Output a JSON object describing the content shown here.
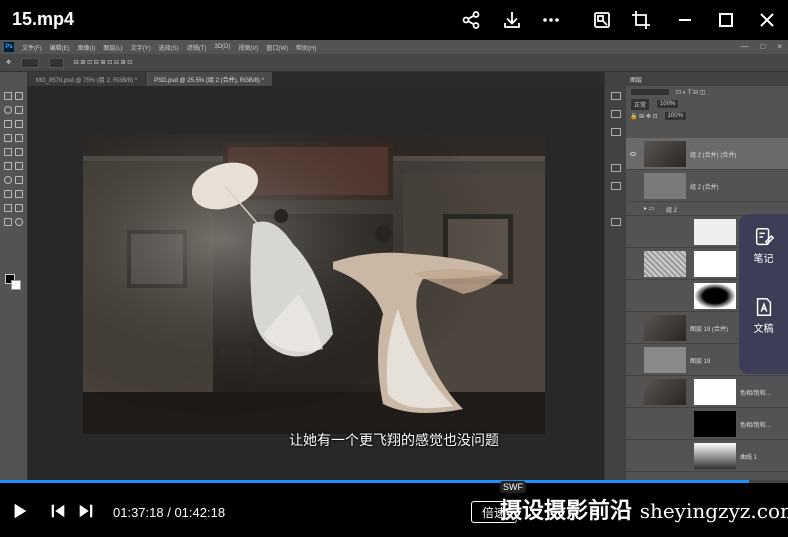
{
  "player": {
    "title": "15.mp4",
    "time_current": "01:37:18",
    "time_total": "01:42:18",
    "time_display": "01:37:18 / 01:42:18",
    "progress_fraction": 0.951,
    "speed_label": "倍速",
    "subtitle": "让她有一个更飞翔的感觉也没问题",
    "accent_color": "#1e90ff",
    "icons": [
      "share-icon",
      "download-icon",
      "more-icon",
      "screenshot-icon",
      "crop-icon",
      "minimize-icon",
      "maximize-icon",
      "close-icon",
      "play-icon",
      "previous-icon",
      "next-icon"
    ]
  },
  "watermark": {
    "badge": "SWF",
    "text": "摄设摄影前沿",
    "url": "sheyingzyz.com"
  },
  "side_widget": {
    "note_label": "笔记",
    "doc_label": "文稿"
  },
  "photoshop": {
    "menu": [
      "文件(F)",
      "编辑(E)",
      "图像(I)",
      "图层(L)",
      "文字(Y)",
      "选择(S)",
      "滤镜(T)",
      "3D(D)",
      "视图(V)",
      "窗口(W)",
      "帮助(H)"
    ],
    "tabs": [
      "MG_8570.psd @ 75% (组 2, RGB/8) *",
      "PSD.psd @ 25.5% (组 2 (合并), RGB/8) *"
    ],
    "layers_panel_title": "图层",
    "layers": [
      {
        "name": "组 2 (合并) (合并)"
      },
      {
        "name": "组 2 (合并)"
      },
      {
        "name": "组 2"
      },
      {
        "name": ""
      },
      {
        "name": ""
      },
      {
        "name": ""
      },
      {
        "name": "图层 19 (合并)"
      },
      {
        "name": "图层 19"
      },
      {
        "name": "色相/饱和..."
      },
      {
        "name": "色相/饱和..."
      },
      {
        "name": "曲线 1"
      }
    ],
    "opacity": "100%",
    "fill": "100%",
    "blend_mode": "正常"
  }
}
